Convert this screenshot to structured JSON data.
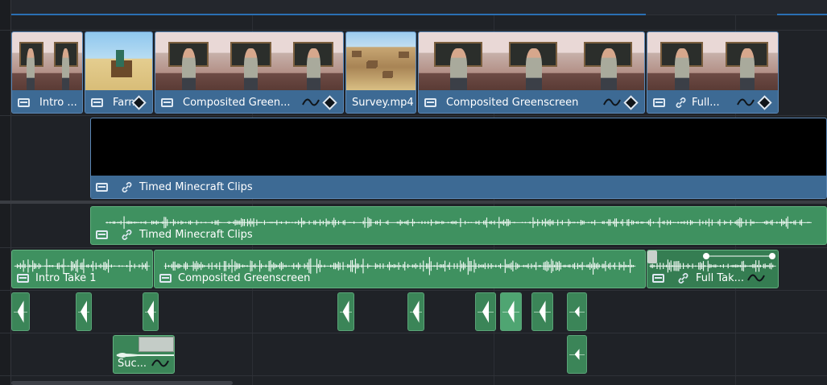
{
  "timeline": {
    "video_track_2": [
      {
        "label": "Intro ...",
        "icons": [
          "film-icon"
        ],
        "thumbs": [
          "classroom",
          "classroom"
        ]
      },
      {
        "label": "Farm...",
        "icons": [
          "film-icon",
          "keyframe-icon"
        ],
        "thumbs": [
          "desert"
        ]
      },
      {
        "label": "Composited Green...",
        "icons": [
          "film-icon",
          "curve-icon",
          "keyframe-icon"
        ],
        "thumbs": [
          "classroom",
          "classroom",
          "classroom"
        ]
      },
      {
        "label": "Survey.mp4",
        "icons": [],
        "thumbs": [
          "village"
        ]
      },
      {
        "label": "Composited Greenscreen",
        "icons": [
          "film-icon",
          "curve-icon",
          "keyframe-icon"
        ],
        "thumbs": [
          "classroom",
          "classroom",
          "classroom"
        ]
      },
      {
        "label": "Full...",
        "icons": [
          "film-icon",
          "link-icon",
          "curve-icon",
          "keyframe-icon"
        ],
        "thumbs": [
          "classroom",
          "classroom"
        ]
      }
    ],
    "video_track_1": {
      "label": "Timed Minecraft Clips",
      "icons": [
        "film-icon",
        "link-icon"
      ]
    },
    "audio_track_1": {
      "label": "Timed Minecraft Clips",
      "icons": [
        "film-icon",
        "link-icon"
      ]
    },
    "audio_track_2": [
      {
        "label": "Intro Take 1",
        "icons": [
          "film-icon"
        ]
      },
      {
        "label": "Composited Greenscreen",
        "icons": [
          "film-icon"
        ]
      },
      {
        "label": "Full Tak...",
        "icons": [
          "film-icon",
          "link-icon",
          "curve-icon"
        ]
      }
    ],
    "audio_track_4": {
      "label": "Suc...",
      "icons": [
        "curve-icon"
      ]
    },
    "colors": {
      "video_clip": "#3d6a94",
      "audio_clip": "#3f9160",
      "background": "#1f2227",
      "playhead_bar": "#2a6fb4"
    }
  }
}
